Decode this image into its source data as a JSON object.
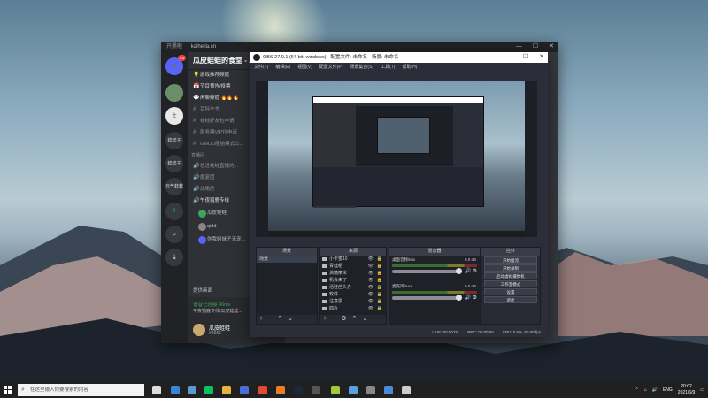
{
  "discord": {
    "brand": "开黑啦",
    "site": "kaiheila.cn",
    "server_name": "瓜皮蛙蛙的食堂 - ...",
    "home_badge": "43",
    "guilds": [
      "蛙蛙子",
      "蛙蛙子",
      "元气蛙蛙"
    ],
    "channels": [
      {
        "icon": "💡",
        "label": "游戏推荐频道"
      },
      {
        "icon": "📅",
        "label": "节目预告/投票"
      },
      {
        "icon": "💬",
        "label": "闲聊频道 🔥🔥🔥"
      },
      {
        "icon": "#",
        "label": "百科全书"
      },
      {
        "icon": "#",
        "label": "蛙蛙好友包申请"
      },
      {
        "icon": "#",
        "label": "服务器VIP位申请"
      },
      {
        "icon": "#",
        "label": "GMOD服始模式公..."
      }
    ],
    "voice_category": "直播间",
    "voice_channels": [
      "想进蛙蛙直播的...",
      "魔宴团",
      "战略房",
      "午夜猎鹿专线"
    ],
    "voice_users": [
      "瓜皮蛙蛙",
      "qidd",
      "你我姐妹子无宠..."
    ],
    "voice_status": "语音已连接 46ms",
    "voice_sub": "午夜猎鹿专线/瓜皮蛙蛙...",
    "screenshare_label": "提供画面",
    "user_name": "瓜皮蛙蛙",
    "user_tag": "#6666"
  },
  "obs": {
    "title": "OBS 27.0.1 (64-bit, windows) - 配置文件: 未命名 - 场景: 未命名",
    "menu": [
      "文件(F)",
      "编辑(E)",
      "视图(V)",
      "配置文件(P)",
      "场景集合(S)",
      "工具(T)",
      "帮助(H)"
    ],
    "docks": {
      "scenes": "场景",
      "sources": "来源",
      "mixer": "混音器",
      "transitions": "转场",
      "controls": "控件"
    },
    "scenes": [
      "场景"
    ],
    "sources": [
      "小卡蜜10",
      "青蛙组",
      "满墙摩米",
      "机会来了",
      "活硅芭头办",
      "软件",
      "注意耍",
      "四片"
    ],
    "mixer": [
      {
        "label": "桌面音频/Mix",
        "db": "0.0 dB"
      },
      {
        "label": "麦克风/Aux",
        "db": "0.0 dB"
      }
    ],
    "controls": [
      "开始推流",
      "开始录制",
      "启动虚拟摄像机",
      "工作室模式",
      "设置",
      "退出"
    ],
    "status": {
      "live": "LIVE: 00:00:00",
      "rec": "REC: 00:00:00",
      "cpu": "CPU: 0.5%, 60.00 fps"
    }
  },
  "taskbar": {
    "search_placeholder": "在这里输入你要搜索的内容",
    "time": "20:02",
    "date": "2021/6/9",
    "lang": "ENG"
  }
}
